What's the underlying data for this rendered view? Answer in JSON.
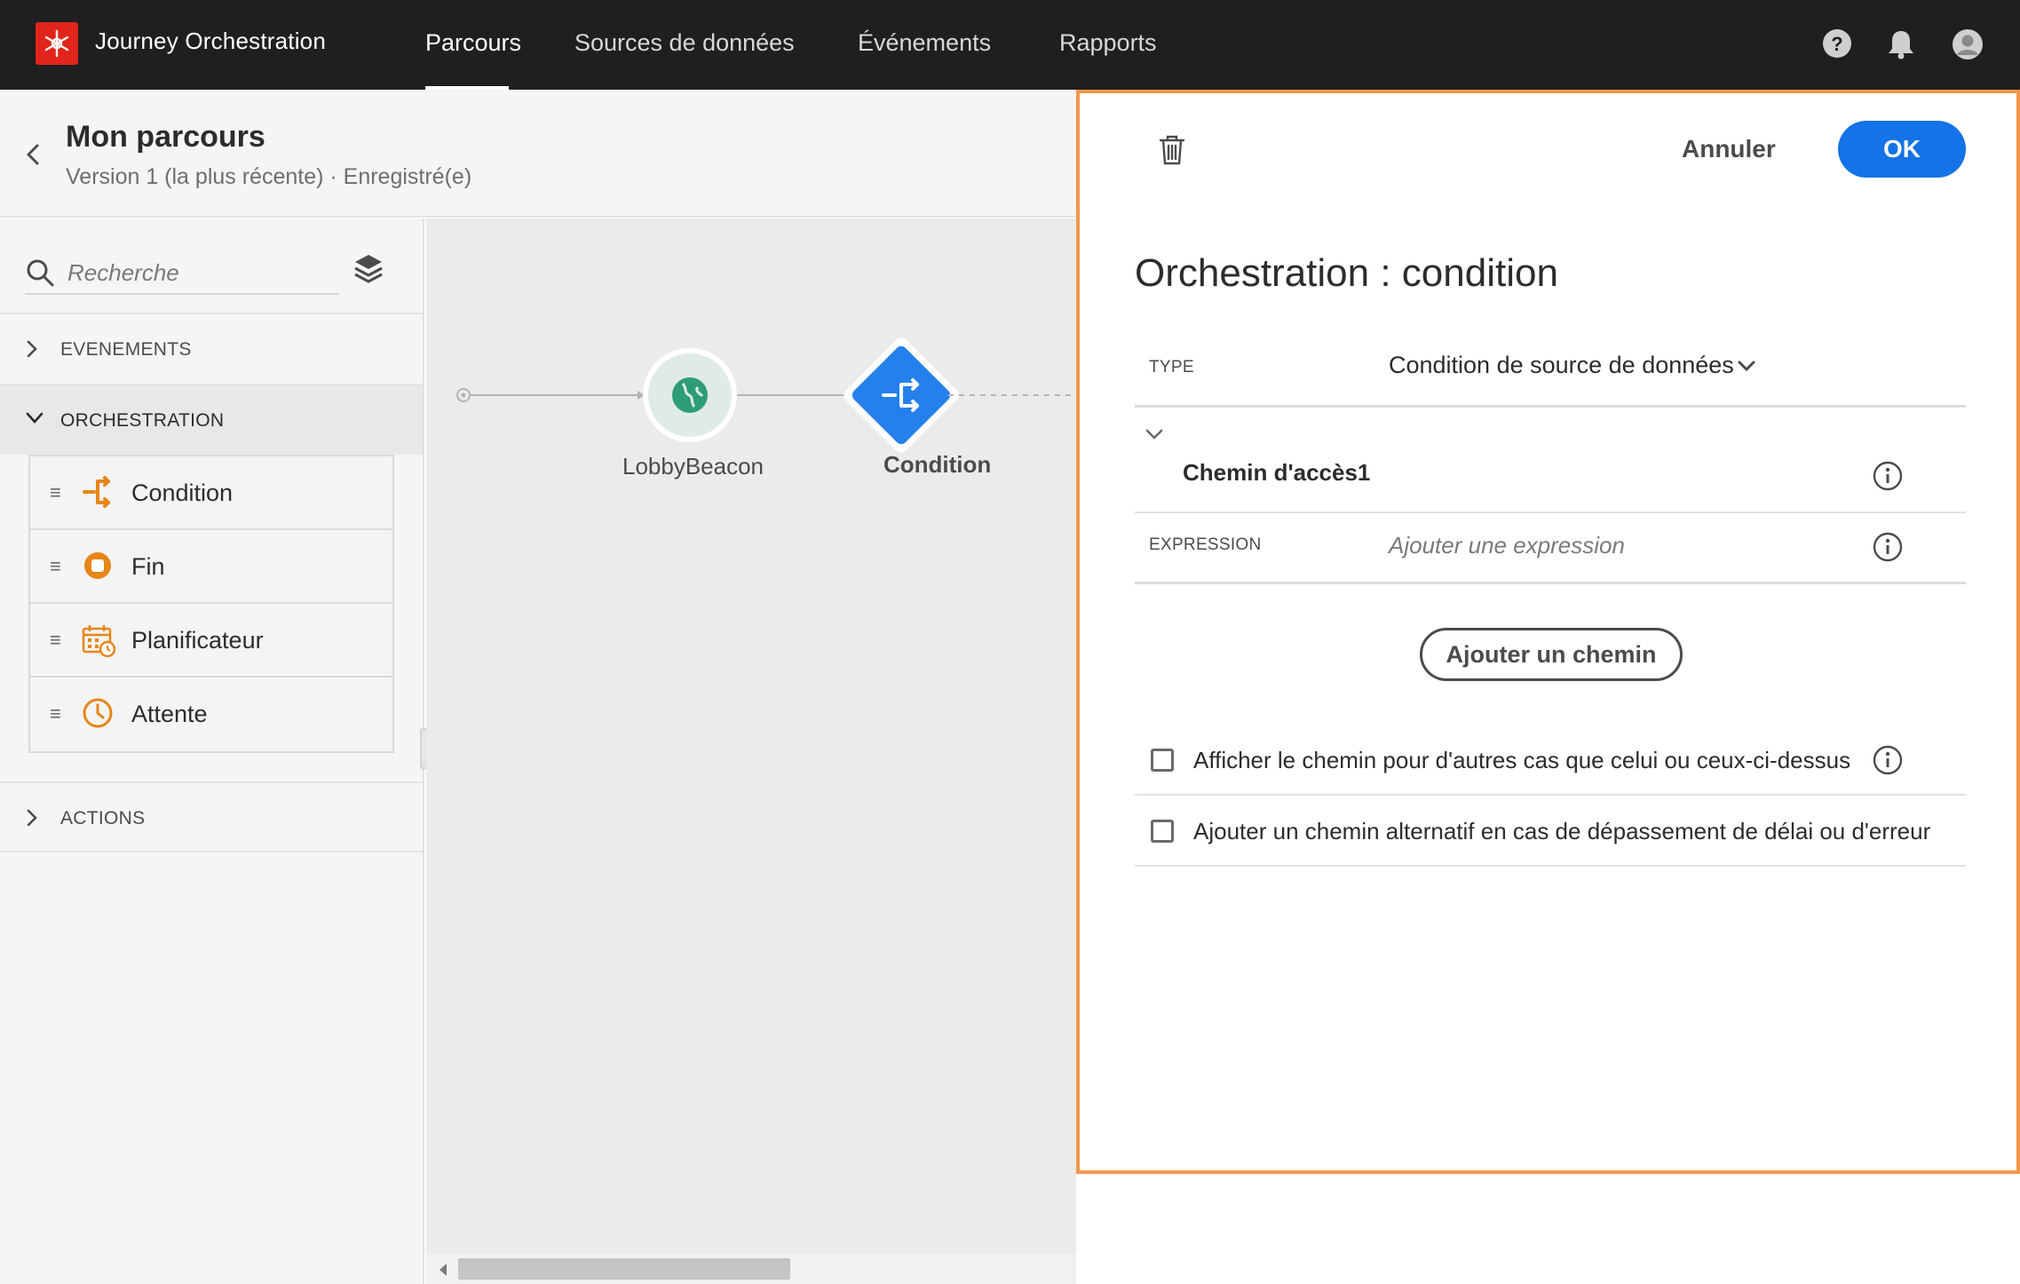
{
  "app": {
    "title": "Journey Orchestration",
    "nav": [
      "Parcours",
      "Sources de données",
      "Événements",
      "Rapports"
    ],
    "active_nav": "Parcours"
  },
  "journey": {
    "title": "Mon parcours",
    "subtitle": "Version 1 (la plus récente) · Enregistré(e)"
  },
  "palette": {
    "search_placeholder": "Recherche",
    "sections": {
      "events": "EVENEMENTS",
      "orchestration": "ORCHESTRATION",
      "actions": "ACTIONS"
    },
    "orchestration_items": [
      {
        "label": "Condition",
        "icon": "condition-icon"
      },
      {
        "label": "Fin",
        "icon": "end-icon"
      },
      {
        "label": "Planificateur",
        "icon": "scheduler-icon"
      },
      {
        "label": "Attente",
        "icon": "wait-icon"
      }
    ]
  },
  "canvas": {
    "nodes": [
      {
        "label": "LobbyBeacon",
        "icon": "globe-icon"
      },
      {
        "label": "Condition",
        "icon": "condition-icon"
      }
    ]
  },
  "panel": {
    "cancel_label": "Annuler",
    "ok_label": "OK",
    "title": "Orchestration : condition",
    "type_label": "TYPE",
    "type_value": "Condition de source de données",
    "path_name": "Chemin d'accès1",
    "expression_label": "EXPRESSION",
    "expression_placeholder": "Ajouter une expression",
    "add_path_label": "Ajouter un chemin",
    "options": [
      {
        "label": "Afficher le chemin pour d'autres cas que celui ou ceux-ci-dessus",
        "checked": false
      },
      {
        "label": "Ajouter un chemin alternatif en cas de dépassement de délai ou d'erreur",
        "checked": false
      }
    ]
  },
  "colors": {
    "accent": "#1473e6",
    "highlight_border": "#f2974a",
    "brand": "#e1251b",
    "palette_icon": "#e68619",
    "topbar": "#1f1f1f"
  }
}
